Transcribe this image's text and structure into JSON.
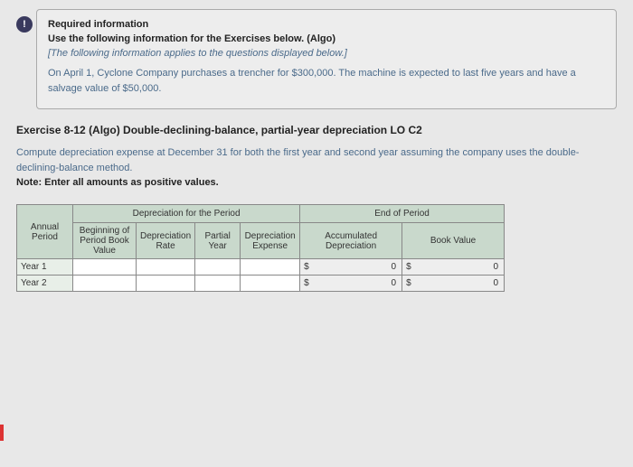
{
  "badge": "!",
  "required": {
    "heading": "Required information",
    "subheading": "Use the following information for the Exercises below. (Algo)",
    "italic": "[The following information applies to the questions displayed below.]",
    "body": "On April 1, Cyclone Company purchases a trencher for $300,000. The machine is expected to last five years and have a salvage value of $50,000."
  },
  "exercise": {
    "title": "Exercise 8-12 (Algo) Double-declining-balance, partial-year depreciation LO C2",
    "body": "Compute depreciation expense at December 31 for both the first year and second year assuming the company uses the double-declining-balance method.",
    "note": "Note: Enter all amounts as positive values."
  },
  "table": {
    "group1": "Depreciation for the Period",
    "group2": "End of Period",
    "headers": {
      "period": "Annual Period",
      "beg": "Beginning of Period Book Value",
      "rate": "Depreciation Rate",
      "partial": "Partial Year",
      "expense": "Depreciation Expense",
      "accum": "Accumulated Depreciation",
      "book": "Book Value"
    },
    "rows": [
      {
        "label": "Year 1",
        "accum_cur": "$",
        "accum_val": "0",
        "book_cur": "$",
        "book_val": "0"
      },
      {
        "label": "Year 2",
        "accum_cur": "$",
        "accum_val": "0",
        "book_cur": "$",
        "book_val": "0"
      }
    ]
  }
}
